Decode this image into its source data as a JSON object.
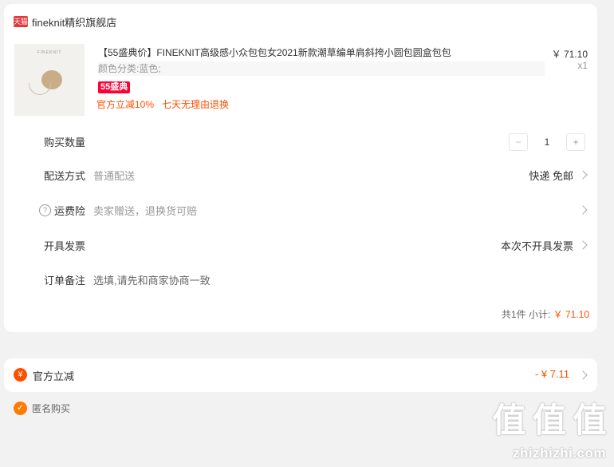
{
  "shop": {
    "badge": "天猫",
    "name": "fineknit精织旗舰店"
  },
  "item": {
    "thumb_brand": "FINEKNIT",
    "title": "【55盛典价】FINEKNIT高级感小众包包女2021新款潮草编单肩斜挎小圆包圆盒包包",
    "sku": "颜色分类:蓝色;",
    "promo_tag": "55盛典",
    "service_1": "官方立减10%",
    "service_2": "七天无理由退换",
    "price": "￥ 71.10",
    "qty_mark": "x1"
  },
  "rows": {
    "qty_label": "购买数量",
    "qty_minus": "−",
    "qty_value": "1",
    "qty_plus": "+",
    "ship_label": "配送方式",
    "ship_sub": "普通配送",
    "ship_value": "快递 免邮",
    "ins_help": "?",
    "ins_label": "运费险",
    "ins_sub": "卖家赠送，退换货可赔",
    "inv_label": "开具发票",
    "inv_value": "本次不开具发票",
    "note_label": "订单备注",
    "note_placeholder": "选填,请先和商家协商一致"
  },
  "subtotal": {
    "count": "共1件",
    "label": "小计:",
    "amount": "￥ 71.10"
  },
  "discount": {
    "icon": "¥",
    "label": "官方立减",
    "amount": "- ¥ 7.11"
  },
  "anon": {
    "check": "✓",
    "label": "匿名购买"
  },
  "watermark": {
    "chars": [
      "值",
      "值",
      "值"
    ],
    "url": "zhizhizhi.com"
  },
  "colors": {
    "accent": "#ff5000",
    "tmall_red": "#e4393c",
    "promo_red": "#ff0036"
  }
}
